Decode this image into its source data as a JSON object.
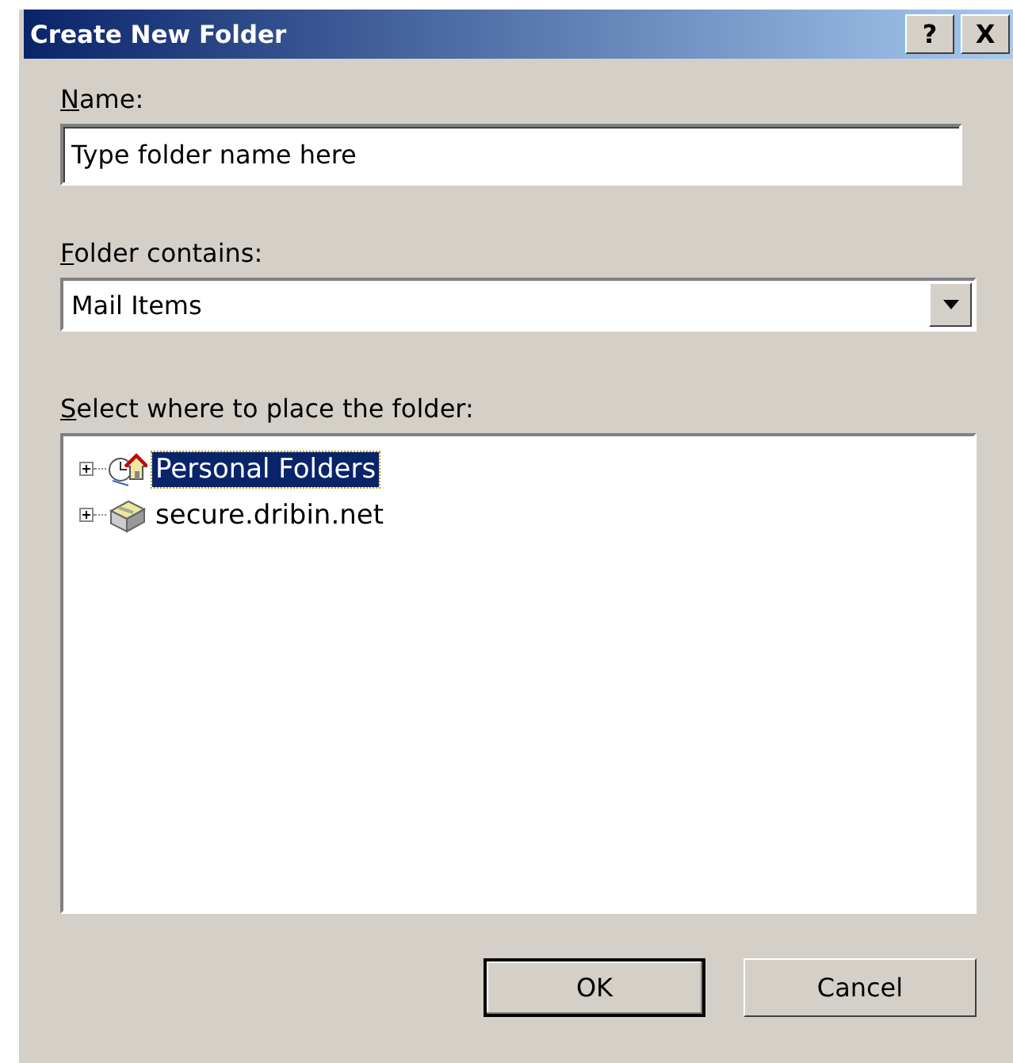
{
  "window": {
    "title": "Create New Folder",
    "buttons": [
      "?",
      "X"
    ]
  },
  "name_field": {
    "label": "Name:",
    "value": "Type folder name here"
  },
  "contains": {
    "label": "Folder contains:",
    "value": "Mail Items"
  },
  "location": {
    "label": "Select where to place the folder:",
    "items": [
      {
        "label": "Personal Folders",
        "kind": "home",
        "expanded": false,
        "selected": true
      },
      {
        "label": "secure.dribin.net",
        "kind": "server",
        "expanded": false,
        "selected": false
      }
    ]
  },
  "buttons": [
    {
      "label": "OK",
      "default": true
    },
    {
      "label": "Cancel",
      "default": false
    }
  ]
}
